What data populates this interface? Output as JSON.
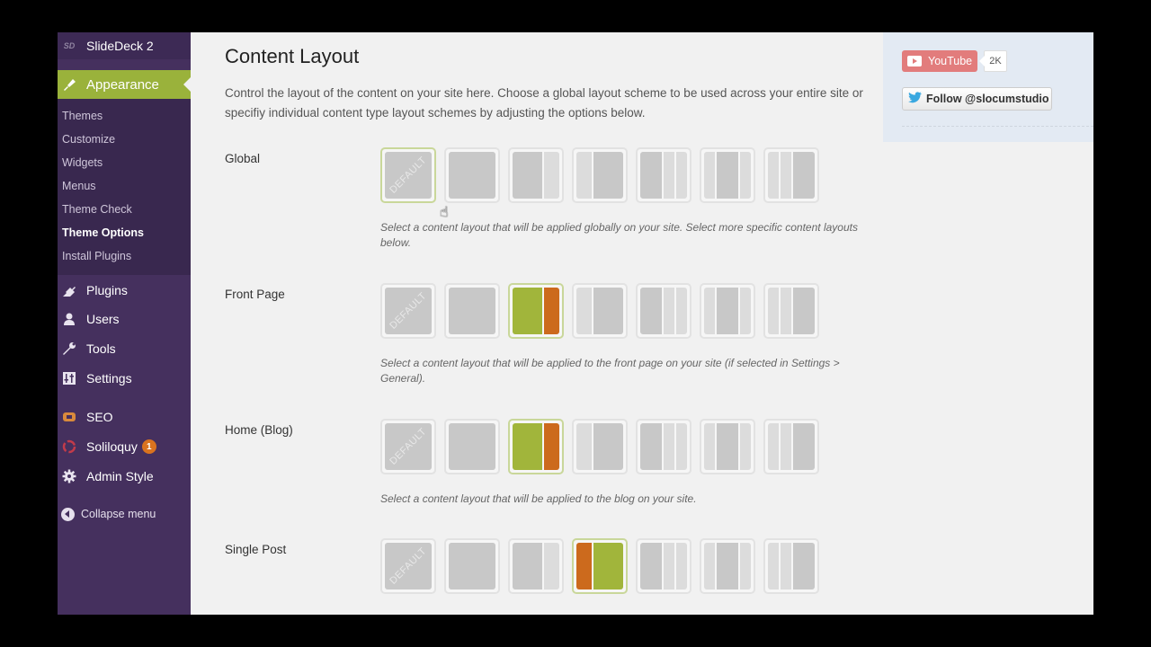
{
  "sidebar": {
    "plugin_top": {
      "label": "SlideDeck 2",
      "icon": "slidedeck-logo-icon",
      "icon_text": "SD"
    },
    "appearance": {
      "label": "Appearance",
      "icon": "paintbrush-icon",
      "accent": "#9ab23b"
    },
    "submenu": [
      {
        "label": "Themes",
        "active": false
      },
      {
        "label": "Customize",
        "active": false
      },
      {
        "label": "Widgets",
        "active": false
      },
      {
        "label": "Menus",
        "active": false
      },
      {
        "label": "Theme Check",
        "active": false
      },
      {
        "label": "Theme Options",
        "active": true
      },
      {
        "label": "Install Plugins",
        "active": false
      }
    ],
    "items": [
      {
        "label": "Plugins",
        "icon": "plug-icon"
      },
      {
        "label": "Users",
        "icon": "user-icon"
      },
      {
        "label": "Tools",
        "icon": "wrench-icon"
      },
      {
        "label": "Settings",
        "icon": "sliders-icon"
      },
      {
        "label": "SEO",
        "icon": "seo-icon"
      },
      {
        "label": "Soliloquy",
        "icon": "soliloquy-icon",
        "badge": "1"
      },
      {
        "label": "Admin Style",
        "icon": "gear-icon"
      }
    ],
    "collapse_label": "Collapse menu",
    "colors": {
      "background": "#45305e",
      "badge": "#d9731f"
    }
  },
  "main": {
    "title": "Content Layout",
    "intro": "Control the layout of the content on your site here. Choose a global layout scheme to be used across your entire site or specifiy individual content type layout schemes by adjusting the options below.",
    "default_label": "DEFAULT",
    "layout_options": [
      "default",
      "full-width",
      "content-sidebar",
      "sidebar-content",
      "content-sidebar-sidebar",
      "sidebar-content-sidebar",
      "sidebar-sidebar-content"
    ],
    "rows": [
      {
        "label": "Global",
        "selected": 0,
        "help": "Select a content layout that will be applied globally on your site. Select more specific content layouts below."
      },
      {
        "label": "Front Page",
        "selected": 2,
        "help": "Select a content layout that will be applied to the front page on your site (if selected in Settings > General)."
      },
      {
        "label": "Home (Blog)",
        "selected": 2,
        "help": "Select a content layout that will be applied to the blog on your site."
      },
      {
        "label": "Single Post",
        "selected": 3,
        "help": ""
      }
    ],
    "colors": {
      "content": "#a1b53b",
      "sidebar": "#cc6a1d"
    }
  },
  "social": {
    "youtube_label": "YouTube",
    "youtube_count": "2K",
    "twitter_label": "Follow @slocumstudio"
  }
}
